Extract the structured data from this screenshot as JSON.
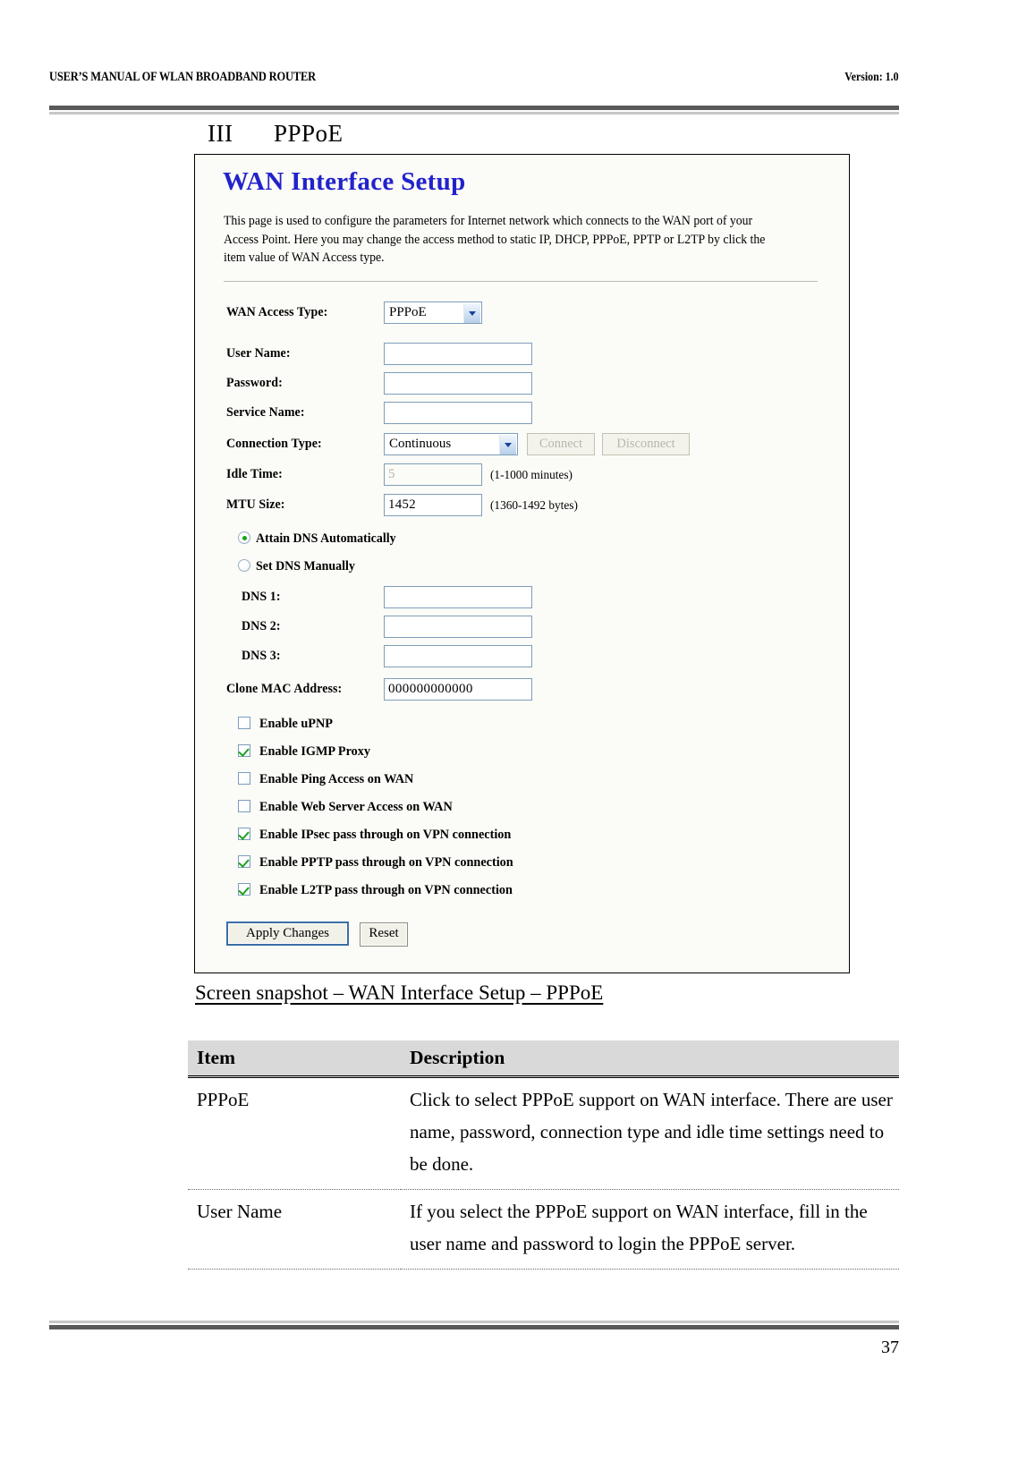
{
  "header": {
    "left_title": "USER’S MANUAL OF WLAN BROADBAND ROUTER",
    "right_version": "Version: 1.0"
  },
  "section": {
    "number": "III",
    "title": "PPPoE"
  },
  "screenshot": {
    "title": "WAN Interface Setup",
    "description": "This page is used to configure the parameters for Internet network which connects to the WAN port of your Access Point. Here you may change the access method to static IP, DHCP, PPPoE, PPTP or L2TP by click the item value of WAN Access type.",
    "fields": {
      "wan_access_type_label": "WAN Access Type:",
      "wan_access_type_value": "PPPoE",
      "user_name_label": "User Name:",
      "user_name_value": "",
      "password_label": "Password:",
      "password_value": "",
      "service_name_label": "Service Name:",
      "service_name_value": "",
      "connection_type_label": "Connection Type:",
      "connection_type_value": "Continuous",
      "connect_button": "Connect",
      "disconnect_button": "Disconnect",
      "idle_time_label": "Idle Time:",
      "idle_time_value": "5",
      "idle_time_hint": "(1-1000 minutes)",
      "mtu_size_label": "MTU Size:",
      "mtu_size_value": "1452",
      "mtu_size_hint": "(1360-1492 bytes)",
      "attain_dns_label": "Attain DNS Automatically",
      "set_dns_label": "Set DNS Manually",
      "dns1_label": "DNS 1:",
      "dns1_value": "",
      "dns2_label": "DNS 2:",
      "dns2_value": "",
      "dns3_label": "DNS 3:",
      "dns3_value": "",
      "clone_mac_label": "Clone MAC Address:",
      "clone_mac_value": "000000000000"
    },
    "checkboxes": [
      {
        "label": "Enable uPNP",
        "checked": false
      },
      {
        "label": "Enable IGMP Proxy",
        "checked": true
      },
      {
        "label": "Enable Ping Access on WAN",
        "checked": false
      },
      {
        "label": "Enable Web Server Access on WAN",
        "checked": false
      },
      {
        "label": "Enable IPsec pass through on VPN connection",
        "checked": true
      },
      {
        "label": "Enable PPTP pass through on VPN connection",
        "checked": true
      },
      {
        "label": "Enable L2TP pass through on VPN connection",
        "checked": true
      }
    ],
    "buttons": {
      "apply": "Apply Changes",
      "reset": "Reset"
    },
    "dns_mode": "attain_automatically",
    "colors": {
      "title_blue": "#2222cc",
      "field_border": "#7f9db9",
      "check_green": "#1ea11e",
      "focus_blue": "#3a6ea5"
    }
  },
  "caption": "Screen snapshot – WAN Interface Setup – PPPoE",
  "table": {
    "headers": [
      "Item",
      "Description"
    ],
    "rows": [
      {
        "item": "PPPoE",
        "description": "Click to select PPPoE support on WAN interface. There are user name, password, connection type and idle time settings need to be done."
      },
      {
        "item": "User Name",
        "description": "If you select the PPPoE support on WAN interface, fill in the user name and password to login the PPPoE server."
      }
    ]
  },
  "footer": {
    "page_number": "37"
  }
}
